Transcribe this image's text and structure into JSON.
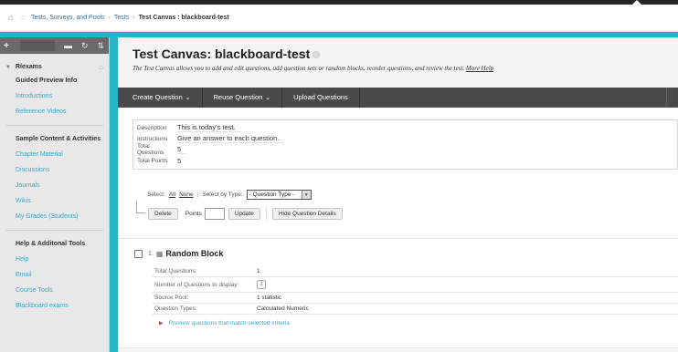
{
  "breadcrumb": {
    "items": [
      "Tests, Surveys, and Pools",
      "Tests"
    ],
    "current": "Test Canvas : blackboard-test"
  },
  "sidebar": {
    "course_name": "Rlexams",
    "groups": [
      {
        "items": [
          "Guided Preview Info",
          "Introductions",
          "Reference Videos"
        ]
      },
      {
        "items": [
          "Sample Content & Activities",
          "Chapter Material",
          "Discussions",
          "Journals",
          "Wikis",
          "My Grades (Students)"
        ]
      },
      {
        "items": [
          "Help & Additonal Tools",
          "Help",
          "Email",
          "Course Tools",
          "Blackboard exams"
        ]
      }
    ]
  },
  "page": {
    "title": "Test Canvas: blackboard-test",
    "subtitle": "The Test Canvas allows you to add and edit questions, add question sets or random blocks, reorder questions, and review the test.",
    "more_help": "More Help"
  },
  "action_bar": {
    "create_question": "Create Question",
    "reuse_question": "Reuse Question",
    "upload_questions": "Upload Questions"
  },
  "info": {
    "description_label": "Description",
    "description": "This is today's test.",
    "instructions_label": "Instructions",
    "instructions": "Give an answer to each question.",
    "total_questions_label": "Total Questions",
    "total_questions": "5",
    "total_points_label": "Total Points",
    "total_points": "5"
  },
  "select_row": {
    "select_label": "Select:",
    "all": "All",
    "none": "None",
    "select_by_type": "Select by Type:",
    "type_value": "- Question Type -"
  },
  "buttons": {
    "delete": "Delete",
    "points_label": "Points",
    "update": "Update",
    "hide_details": "Hide Question Details"
  },
  "question": {
    "number": "1.",
    "title": "Random Block",
    "rows": [
      {
        "label": "Total Questions:",
        "value": "1"
      },
      {
        "label": "Number of Questions to display:",
        "value": "1"
      },
      {
        "label": "Source Pool:",
        "value": "1 statistic"
      },
      {
        "label": "Question Types:",
        "value": "Calculated Numeric"
      }
    ],
    "preview_link": "Preview questions that match selected criteria"
  }
}
